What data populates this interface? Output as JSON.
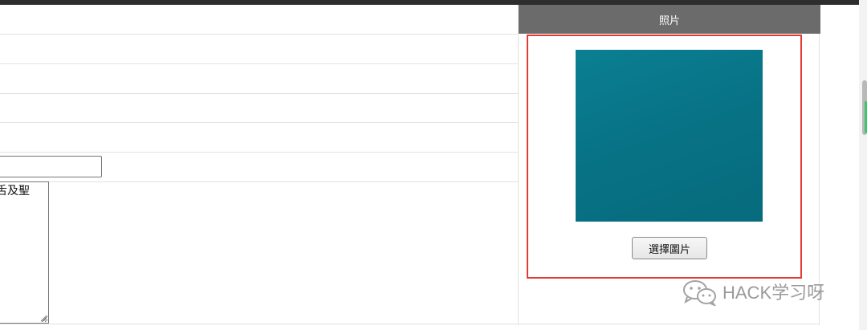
{
  "photo_panel": {
    "header_label": "照片",
    "choose_button_label": "選擇圖片",
    "preview_color": "#087688"
  },
  "form": {
    "textarea_value": "舌及聖",
    "text_input_value": ""
  },
  "watermark": {
    "text": "HACK学习呀"
  },
  "colors": {
    "header_bg": "#6b6b6b",
    "highlight_border": "#e53935",
    "top_bar": "#2d2d2d"
  }
}
